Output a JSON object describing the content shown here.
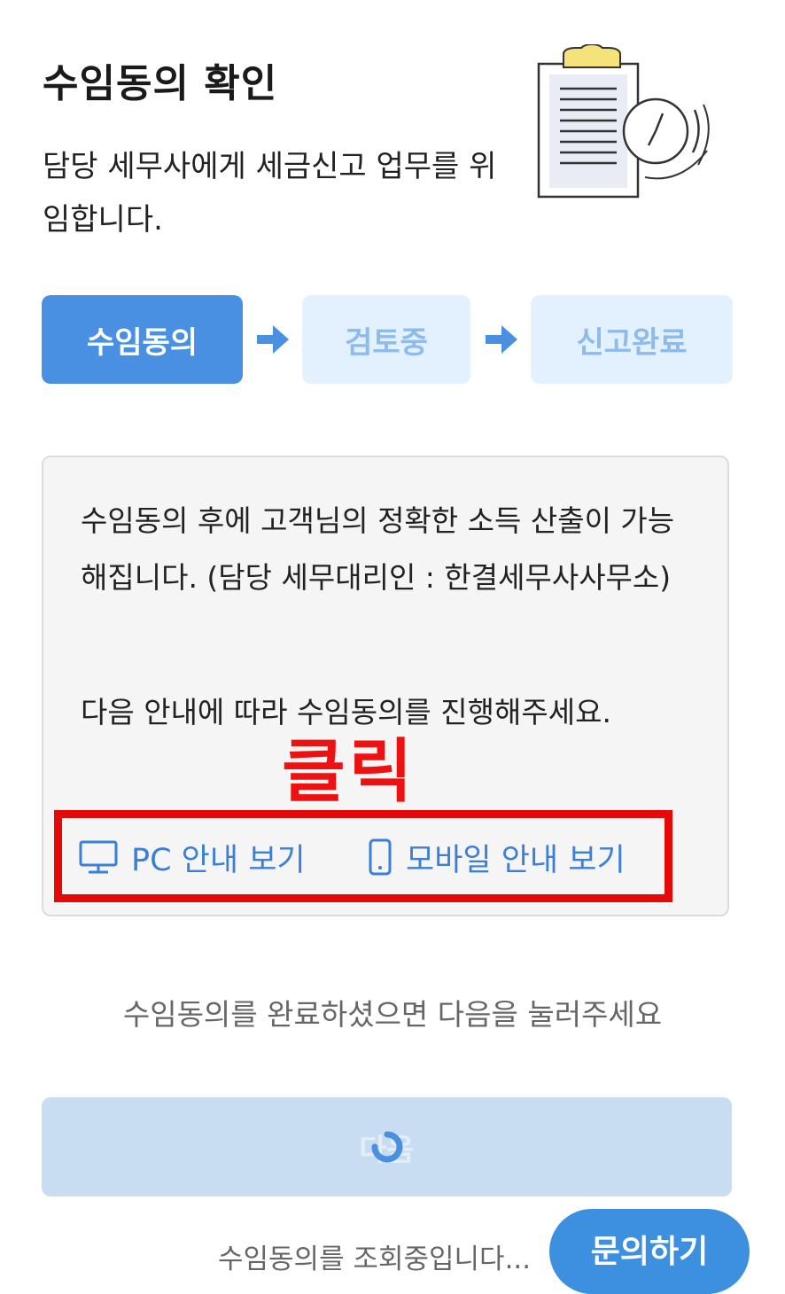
{
  "header": {
    "title": "수임동의 확인",
    "subtitle": "담당 세무사에게 세금신고 업무를 위임합니다.",
    "illustration_icon": "clipboard-clock-icon"
  },
  "steps": [
    {
      "label": "수임동의",
      "state": "active"
    },
    {
      "label": "검토중",
      "state": "pending"
    },
    {
      "label": "신고완료",
      "state": "pending"
    }
  ],
  "info": {
    "paragraph1": "수임동의 후에 고객님의 정확한 소득 산출이 가능해집니다. (담당 세무대리인 : 한결세무사사무소)",
    "paragraph2": "다음 안내에 따라 수임동의를 진행해주세요.",
    "annotation": "클릭",
    "pc_guide_label": "PC 안내 보기",
    "mobile_guide_label": "모바일 안내 보기"
  },
  "hint": "수임동의를 완료하셨으면 다음을 눌러주세요",
  "next_button": {
    "label": "다음",
    "state": "loading"
  },
  "loading_text": "수임동의를 조회중입니다...",
  "inquiry_button": "문의하기",
  "colors": {
    "accent": "#4a90e2",
    "step_pending_bg": "#e3f0fd",
    "step_pending_text": "#8dbbec",
    "link": "#3c7fd6",
    "annotation_red": "#e50a0a",
    "disabled_button": "#c8dcf2"
  }
}
